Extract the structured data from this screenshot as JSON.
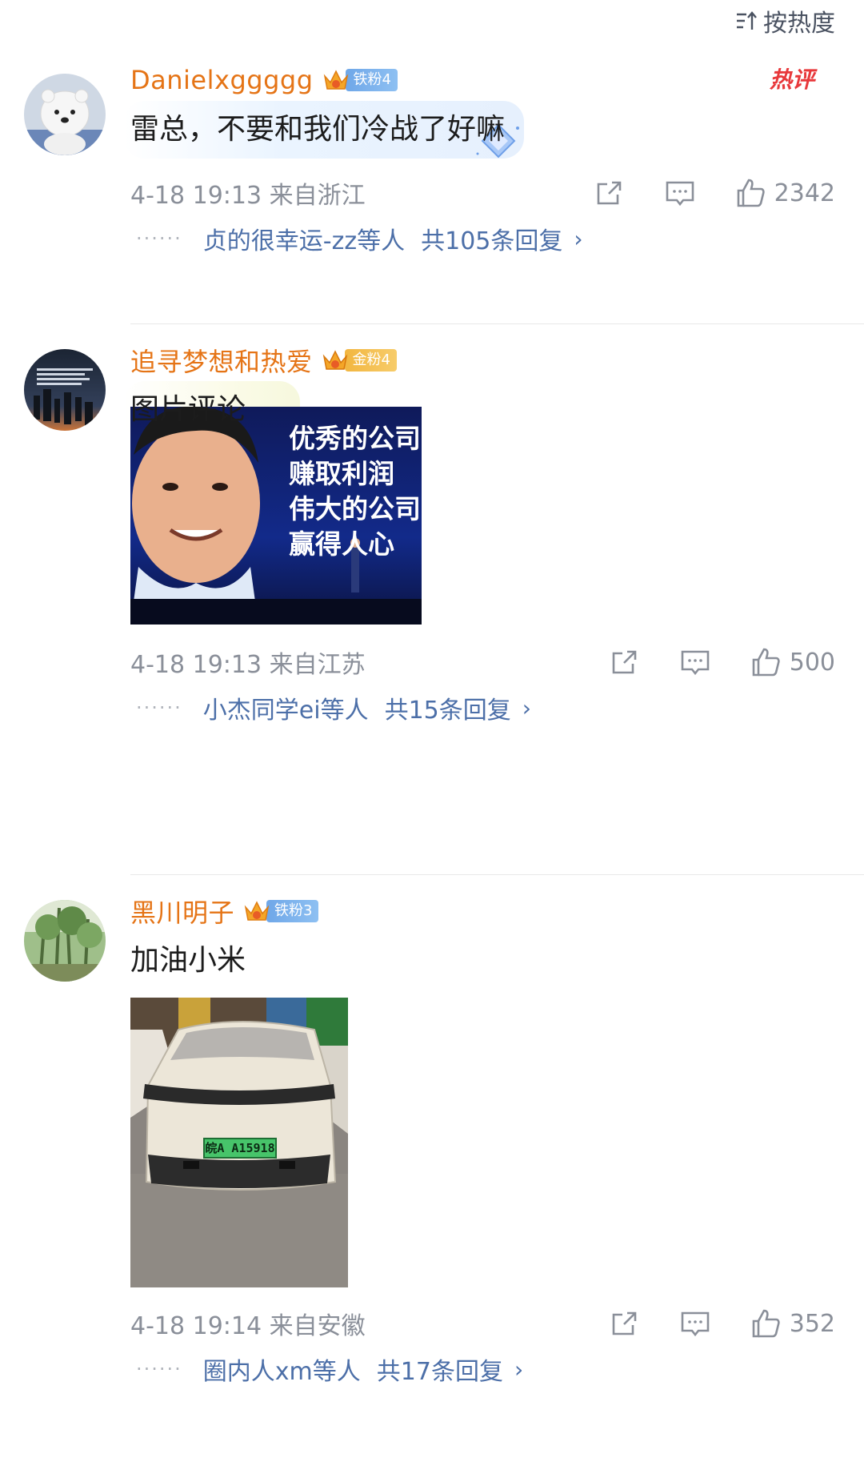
{
  "sort": {
    "label": "按热度",
    "icon": "sort-icon"
  },
  "comments": [
    {
      "user": "Danielxggggg",
      "fan_badge": "铁粉4",
      "fan_type": "iron",
      "hot_tag": "热评",
      "text": "雷总，不要和我们冷战了好嘛",
      "meta": "4-18 19:13 来自浙江",
      "likes": "2342",
      "reply_users": "贞的很幸运-zz",
      "reply_others": "等人",
      "reply_count": "共105条回复",
      "reply_arrow": "›"
    },
    {
      "user": "追寻梦想和热爱",
      "fan_badge": "金粉4",
      "fan_type": "gold",
      "text": "图片评论",
      "image_text": [
        "优秀的公司",
        "赚取利润",
        "伟大的公司",
        "赢得人心"
      ],
      "meta": "4-18 19:13 来自江苏",
      "likes": "500",
      "reply_users": "小杰同学ei",
      "reply_others": "等人",
      "reply_count": "共15条回复",
      "reply_arrow": "›"
    },
    {
      "user": "黑川明子",
      "fan_badge": "铁粉3",
      "fan_type": "iron",
      "text": "加油小米",
      "image_plate": "皖A A15918",
      "meta": "4-18 19:14 来自安徽",
      "likes": "352",
      "reply_users": "圈内人xm",
      "reply_others": "等人",
      "reply_count": "共17条回复",
      "reply_arrow": "›"
    }
  ],
  "colors": {
    "username": "#e57416",
    "link": "#4c6fa8",
    "meta": "#8a8f99",
    "hot": "#e8383b"
  }
}
